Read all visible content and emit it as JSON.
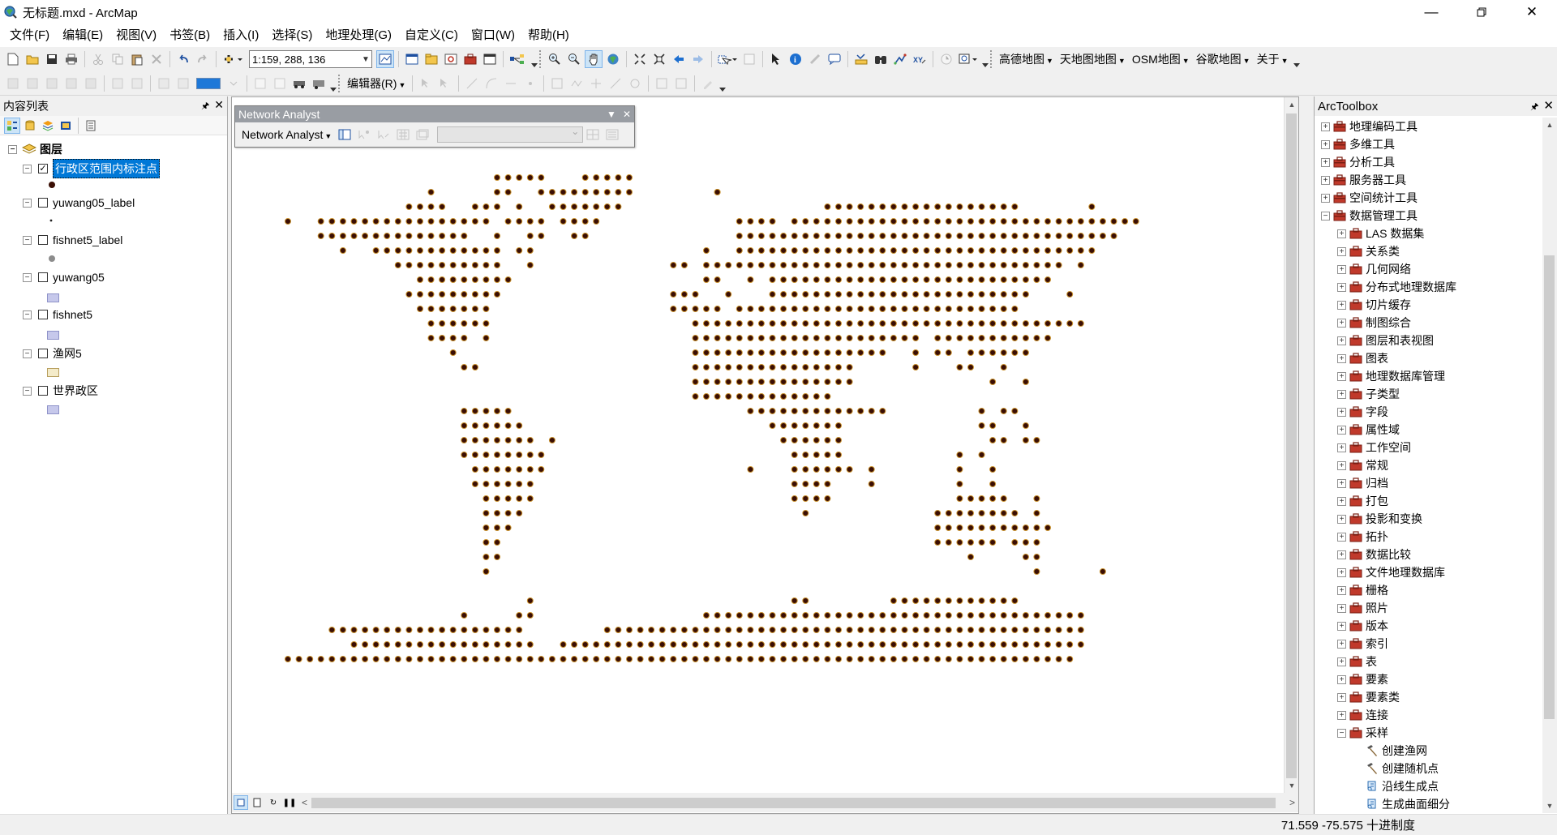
{
  "window": {
    "title": "无标题.mxd - ArcMap",
    "minimize_icon": "minimize-icon",
    "maximize_icon": "restore-icon",
    "close_icon": "close-icon"
  },
  "menubar": {
    "items": [
      "文件(F)",
      "编辑(E)",
      "视图(V)",
      "书签(B)",
      "插入(I)",
      "选择(S)",
      "地理处理(G)",
      "自定义(C)",
      "窗口(W)",
      "帮助(H)"
    ]
  },
  "toolbar1": {
    "scale": "1:159, 288, 136",
    "text_menus": [
      "高德地图",
      "天地图地图",
      "OSM地图",
      "谷歌地图",
      "关于"
    ]
  },
  "toolbar2": {
    "editor_label": "编辑器(R)"
  },
  "toc": {
    "title": "内容列表",
    "root_label": "图层",
    "layers": [
      {
        "name": "行政区范围内标注点",
        "checked": true,
        "selected": true,
        "symbol": "dark-point"
      },
      {
        "name": "yuwang05_label",
        "checked": false,
        "selected": false,
        "symbol": "small-point"
      },
      {
        "name": "fishnet5_label",
        "checked": false,
        "selected": false,
        "symbol": "gray-point"
      },
      {
        "name": "yuwang05",
        "checked": false,
        "selected": false,
        "symbol": "lavender-fill"
      },
      {
        "name": "fishnet5",
        "checked": false,
        "selected": false,
        "symbol": "lavender-fill"
      },
      {
        "name": "渔网5",
        "checked": false,
        "selected": false,
        "symbol": "beige-fill"
      },
      {
        "name": "世界政区",
        "checked": false,
        "selected": false,
        "symbol": "lavender-fill"
      }
    ]
  },
  "network_analyst": {
    "title": "Network Analyst",
    "menu_label": "Network Analyst"
  },
  "toolbox": {
    "title": "ArcToolbox",
    "top_items": [
      "地理编码工具",
      "多维工具",
      "分析工具",
      "服务器工具",
      "空间统计工具",
      "数据管理工具"
    ],
    "sub_items": [
      "LAS 数据集",
      "关系类",
      "几何网络",
      "分布式地理数据库",
      "切片缓存",
      "制图综合",
      "图层和表视图",
      "图表",
      "地理数据库管理",
      "子类型",
      "字段",
      "属性域",
      "工作空间",
      "常规",
      "归档",
      "打包",
      "投影和变换",
      "拓扑",
      "数据比较",
      "文件地理数据库",
      "栅格",
      "照片",
      "版本",
      "索引",
      "表",
      "要素",
      "要素类",
      "连接",
      "采样"
    ],
    "tools": [
      "创建渔网",
      "创建随机点",
      "沿线生成点",
      "生成曲面细分"
    ]
  },
  "statusbar": {
    "coordinates": "71.559  -75.575 十进制度"
  },
  "colors": {
    "point_fill": "#3a0e04",
    "point_outline": "#c8902c",
    "selection": "#0078d7",
    "toolbox_red": "#c0392b"
  }
}
